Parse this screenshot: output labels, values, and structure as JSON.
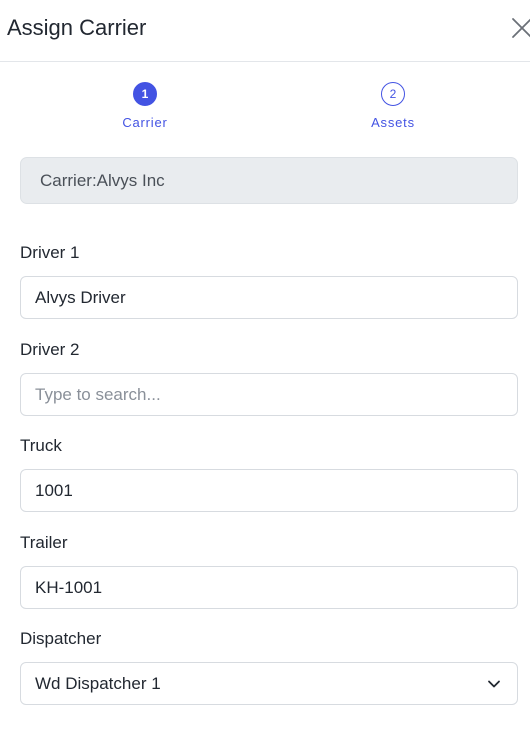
{
  "header": {
    "title": "Assign Carrier",
    "close_icon": "close-icon"
  },
  "stepper": {
    "active_color": "#4353e3",
    "steps": [
      {
        "number": "1",
        "label": "Carrier",
        "state": "active"
      },
      {
        "number": "2",
        "label": "Assets",
        "state": "inactive"
      }
    ]
  },
  "carrier": {
    "text": "Carrier:Alvys Inc"
  },
  "form": {
    "driver1": {
      "label": "Driver 1",
      "value": "Alvys Driver"
    },
    "driver2": {
      "label": "Driver 2",
      "value": "",
      "placeholder": "Type to search..."
    },
    "truck": {
      "label": "Truck",
      "value": "1001"
    },
    "trailer": {
      "label": "Trailer",
      "value": "KH-1001"
    },
    "dispatcher": {
      "label": "Dispatcher",
      "value": "Wd Dispatcher 1",
      "icon": "chevron-down-icon"
    }
  }
}
